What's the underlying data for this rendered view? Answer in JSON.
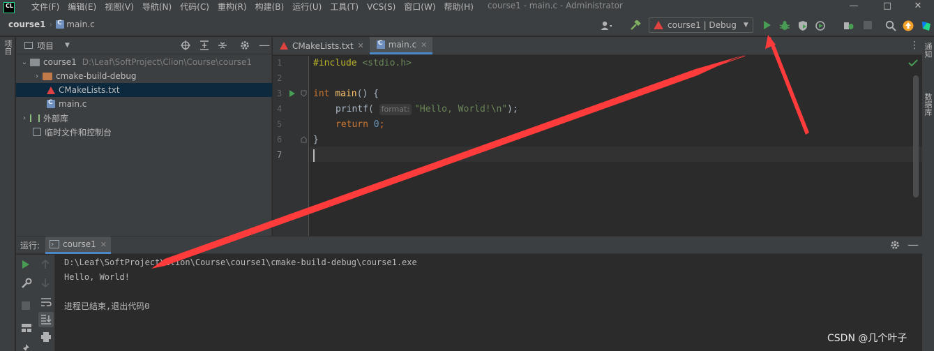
{
  "titlebar": {
    "logo_text": "CL",
    "menu": [
      "文件(F)",
      "编辑(E)",
      "视图(V)",
      "导航(N)",
      "代码(C)",
      "重构(R)",
      "构建(B)",
      "运行(U)",
      "工具(T)",
      "VCS(S)",
      "窗口(W)",
      "帮助(H)"
    ],
    "window_title": "course1 - main.c - Administrator"
  },
  "navbar": {
    "project": "course1",
    "file": "main.c",
    "run_config": "course1 | Debug"
  },
  "left_stripe": {
    "project_tab": "项目"
  },
  "right_stripe": {
    "notifications_tab": "通知",
    "database_tab": "数据库"
  },
  "project_panel": {
    "title": "项目",
    "tree": [
      {
        "label": "course1",
        "path": "D:\\Leaf\\SoftProject\\Clion\\Course\\course1",
        "type": "folder",
        "expanded": true
      },
      {
        "label": "cmake-build-debug",
        "type": "folder-excluded",
        "expanded": false
      },
      {
        "label": "CMakeLists.txt",
        "type": "cmake",
        "selected": true
      },
      {
        "label": "main.c",
        "type": "c-file"
      },
      {
        "label": "外部库",
        "type": "library",
        "expanded": false
      },
      {
        "label": "临时文件和控制台",
        "type": "scratch"
      }
    ]
  },
  "editor": {
    "tabs": [
      {
        "label": "CMakeLists.txt",
        "active": false
      },
      {
        "label": "main.c",
        "active": true
      }
    ],
    "line_numbers": [
      "1",
      "2",
      "3",
      "4",
      "5",
      "6",
      "7"
    ],
    "code": {
      "line1_kw": "#include",
      "line1_header": "<stdio.h>",
      "line3_kw": "int",
      "line3_fn": "main",
      "line3_rest": "() {",
      "line4_fn": "printf",
      "line4_open": "(",
      "line4_hint": "format:",
      "line4_str": "\"Hello, World!\\n\"",
      "line4_close": ");",
      "line5_kw": "return",
      "line5_num": "0",
      "line5_end": ";",
      "line6": "}"
    }
  },
  "run_panel": {
    "label": "运行:",
    "tab": "course1",
    "console": [
      "D:\\Leaf\\SoftProject\\Clion\\Course\\course1\\cmake-build-debug\\course1.exe",
      "Hello, World!",
      "",
      "进程已结束,退出代码0"
    ]
  },
  "watermark": "CSDN @几个叶子",
  "colors": {
    "accent_blue": "#4a88c7",
    "run_green": "#499c54",
    "annotation_red": "#ff3b3b"
  },
  "icons": [
    "search-icon",
    "update-icon",
    "run-icon",
    "debug-icon",
    "hammer-icon",
    "gear-icon",
    "close-icon"
  ]
}
